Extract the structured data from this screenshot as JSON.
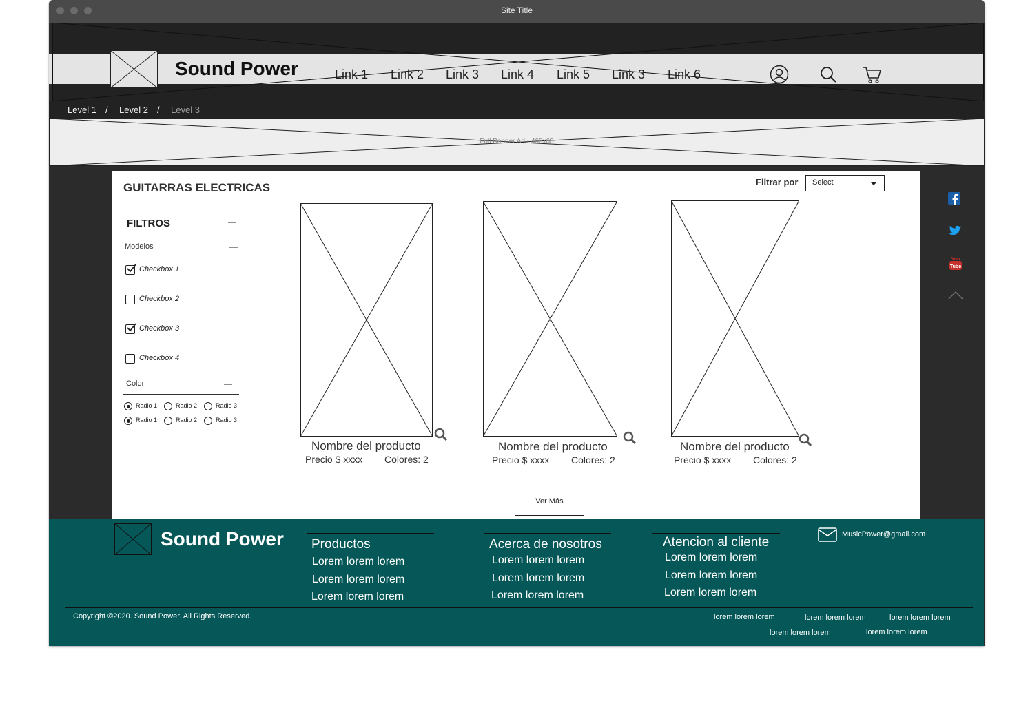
{
  "window": {
    "title": "Site Title"
  },
  "brand": {
    "name": "Sound Power"
  },
  "nav": {
    "links": [
      "Link 1",
      "Link 2",
      "Link 3",
      "Link 4",
      "Link 5",
      "Link 3",
      "Link 6"
    ]
  },
  "breadcrumb": {
    "items": [
      "Level 1",
      "Level 2",
      "Level 3"
    ],
    "separator": "/"
  },
  "banner": {
    "label": "Full Banner Ad - 468x60"
  },
  "page": {
    "title": "GUITARRAS ELECTRICAS"
  },
  "filter_by": {
    "label": "Filtrar por",
    "select_value": "Select"
  },
  "filters": {
    "title": "FILTROS",
    "collapse_symbol": "—",
    "models": {
      "title": "Modelos",
      "checkboxes": [
        {
          "label": "Checkbox 1",
          "checked": true
        },
        {
          "label": "Checkbox 2",
          "checked": false
        },
        {
          "label": "Checkbox 3",
          "checked": true
        },
        {
          "label": "Checkbox 4",
          "checked": false
        }
      ]
    },
    "color": {
      "title": "Color",
      "radio_rows": [
        [
          "Radio 1",
          "Radio 2",
          "Radio 3"
        ],
        [
          "Radio 1",
          "Radio 2",
          "Radio 3"
        ]
      ],
      "selected_index": 0
    }
  },
  "products": [
    {
      "name": "Nombre del producto",
      "price": "Precio $ xxxx",
      "colors": "Colores: 2"
    },
    {
      "name": "Nombre del producto",
      "price": "Precio $ xxxx",
      "colors": "Colores: 2"
    },
    {
      "name": "Nombre del producto",
      "price": "Precio $ xxxx",
      "colors": "Colores: 2"
    }
  ],
  "more_button": {
    "label": "Ver Más"
  },
  "social": {
    "icons": [
      "facebook-icon",
      "twitter-icon",
      "youtube-icon",
      "scroll-top-icon"
    ],
    "youtube_text": "You Tube"
  },
  "footer": {
    "brand": "Sound Power",
    "columns": [
      {
        "title": "Productos",
        "items": [
          "Lorem lorem lorem",
          "Lorem lorem lorem",
          "Lorem lorem lorem"
        ]
      },
      {
        "title": "Acerca de nosotros",
        "items": [
          "Lorem lorem lorem",
          "Lorem lorem lorem",
          "Lorem lorem lorem"
        ]
      },
      {
        "title": "Atencion al cliente",
        "items": [
          "Lorem lorem lorem",
          "Lorem lorem lorem",
          "Lorem lorem lorem"
        ]
      }
    ],
    "email": "MusicPower@gmail.com",
    "copyright": "Copyright ©2020. Sound Power. All Rights Reserved.",
    "bottom_links": [
      "lorem lorem lorem",
      "lorem lorem lorem",
      "lorem lorem lorem",
      "lorem lorem lorem",
      "lorem lorem lorem"
    ]
  },
  "colors": {
    "footer_bg": "#055758",
    "facebook": "#1b5fa8",
    "twitter": "#1da1f2",
    "youtube": "#c4302b",
    "dark_bg": "#2b2b2b"
  }
}
